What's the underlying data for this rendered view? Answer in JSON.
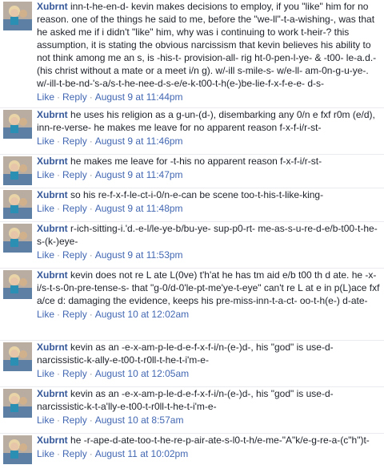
{
  "comments": [
    {
      "author": "Xubrnt",
      "text": "inn-t-he-en-d- kevin makes decisions to employ, if you \"like\" him for no reason. one of the things he said to me, before the \"we-ll\"-t-a-wishing-, was that he asked me if i didn't \"like\" him, why was i continuing to work t-heir-? this assumption, it is stating the obvious narcissism that kevin believes his ability to not think among me an s, is -his-t- provision-all- rig ht-0-pen-l-ye- & -t00- le-a.d.- (his christ without a mate or a meet i/n g). w/-ill s-mile-s- w/e-ll- am-0n-g-u-ye-. w/-ill-t-be-nd-'s-a/s-t-he-nee-d-s-e/e-k-t00-t-h(e-)be-lie-f-x-f-e-e- d-s-",
      "like": "Like",
      "reply": "Reply",
      "time": "August 9 at 11:44pm"
    },
    {
      "author": "Xubrnt",
      "text": "he uses his religion as a g-un-(d-), disembarking any 0/n e fxf r0m (e/d), inn-re-verse- he makes me leave for no apparent reason f-x-f-i/r-st-",
      "like": "Like",
      "reply": "Reply",
      "time": "August 9 at 11:46pm"
    },
    {
      "author": "Xubrnt",
      "text": "he makes me leave for -t-his no apparent reason f-x-f-i/r-st-",
      "like": "Like",
      "reply": "Reply",
      "time": "August 9 at 11:47pm"
    },
    {
      "author": "Xubrnt",
      "text": "so his re-f-x-f-le-ct-i-0/n-e-can be scene too-t-his-t-like-king-",
      "like": "Like",
      "reply": "Reply",
      "time": "August 9 at 11:48pm"
    },
    {
      "author": "Xubrnt",
      "text": "r-ich-sitting-i.'d.-e-l/le-ye-b/bu-ye- sup-p0-rt- me-as-s-u-re-d-e/b-t00-t-he-s-(k-)eye-",
      "like": "Like",
      "reply": "Reply",
      "time": "August 9 at 11:53pm"
    },
    {
      "author": "Xubrnt",
      "text": "kevin does not re L ate L(0ve) t'h'at he has tm aid e/b t00 th d ate. he -x-i/s-t-s-0n-pre-tense-s- that \"g-0/d-0'le-pt-me'ye-t-eye\" can't re L at e in p(L)ace fxf a/ce d: damaging the evidence, keeps his pre-miss-inn-t-a-ct- oo-t-h(e-) d-ate-",
      "like": "Like",
      "reply": "Reply",
      "time": "August 10 at 12:02am"
    },
    {
      "author": "Xubrnt",
      "text": "kevin as an -e-x-am-p-le-d-e-f-x-f-i/n-(e-)d-, his \"god\" is use-d-narcissistic-k-ally-e-t00-t-r0ll-t-he-t-i'm-e-",
      "like": "Like",
      "reply": "Reply",
      "time": "August 10 at 12:05am"
    },
    {
      "author": "Xubrnt",
      "text": "kevin as an -e-x-am-p-le-d-e-f-x-f-i/n-(e-)d-, his \"god\" is use-d-narcissistic-k-t-a'lly-e-t00-t-r0ll-t-he-t-i'm-e-",
      "like": "Like",
      "reply": "Reply",
      "time": "August 10 at 8:57am"
    },
    {
      "author": "Xubrnt",
      "text": "he -r-ape-d-ate-too-t-he-re-p-air-ate-s-l0-t-h/e-me-\"A\"k/e-g-re-a-(c\"h\")t-",
      "like": "Like",
      "reply": "Reply",
      "time": "August 11 at 10:02pm"
    }
  ],
  "separator": "·",
  "icons": {
    "avatar": "user-photo"
  },
  "colors": {
    "author": "#365899",
    "link": "#4267b2",
    "meta": "#90949c",
    "text": "#1d2129"
  }
}
